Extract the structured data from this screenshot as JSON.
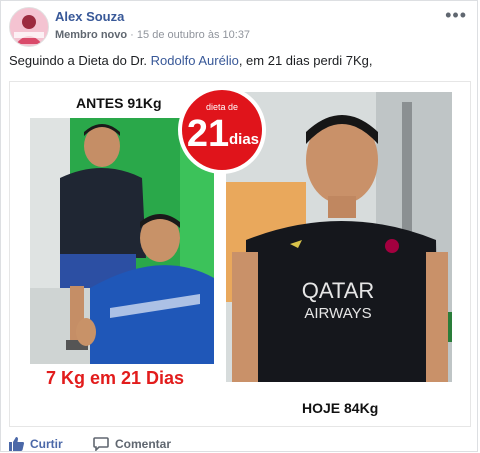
{
  "post": {
    "author": "Alex Souza",
    "role": "Membro novo",
    "separator": " · ",
    "timestamp": "15 de outubro às 10:37",
    "text_before": "Seguindo a Dieta do Dr. ",
    "text_link": "Rodolfo Aurélio",
    "text_after": ", em 21 dias perdi 7Kg,"
  },
  "image": {
    "caption_before": "ANTES 91Kg",
    "badge_small": "dieta de",
    "badge_number": "21",
    "badge_word": "dias",
    "caption_result": "7 Kg em 21 Dias",
    "caption_today": "HOJE 84Kg",
    "shirt_text_1": "QATAR",
    "shirt_text_2": "AIRWAYS"
  },
  "actions": {
    "like_label": "Curtir",
    "comment_label": "Comentar"
  },
  "colors": {
    "link": "#385898",
    "badge_red": "#e0141b",
    "result_red": "#e21c1c",
    "like_blue": "#4b68a8"
  },
  "icons": [
    "more-icon",
    "like-icon",
    "comment-icon"
  ]
}
